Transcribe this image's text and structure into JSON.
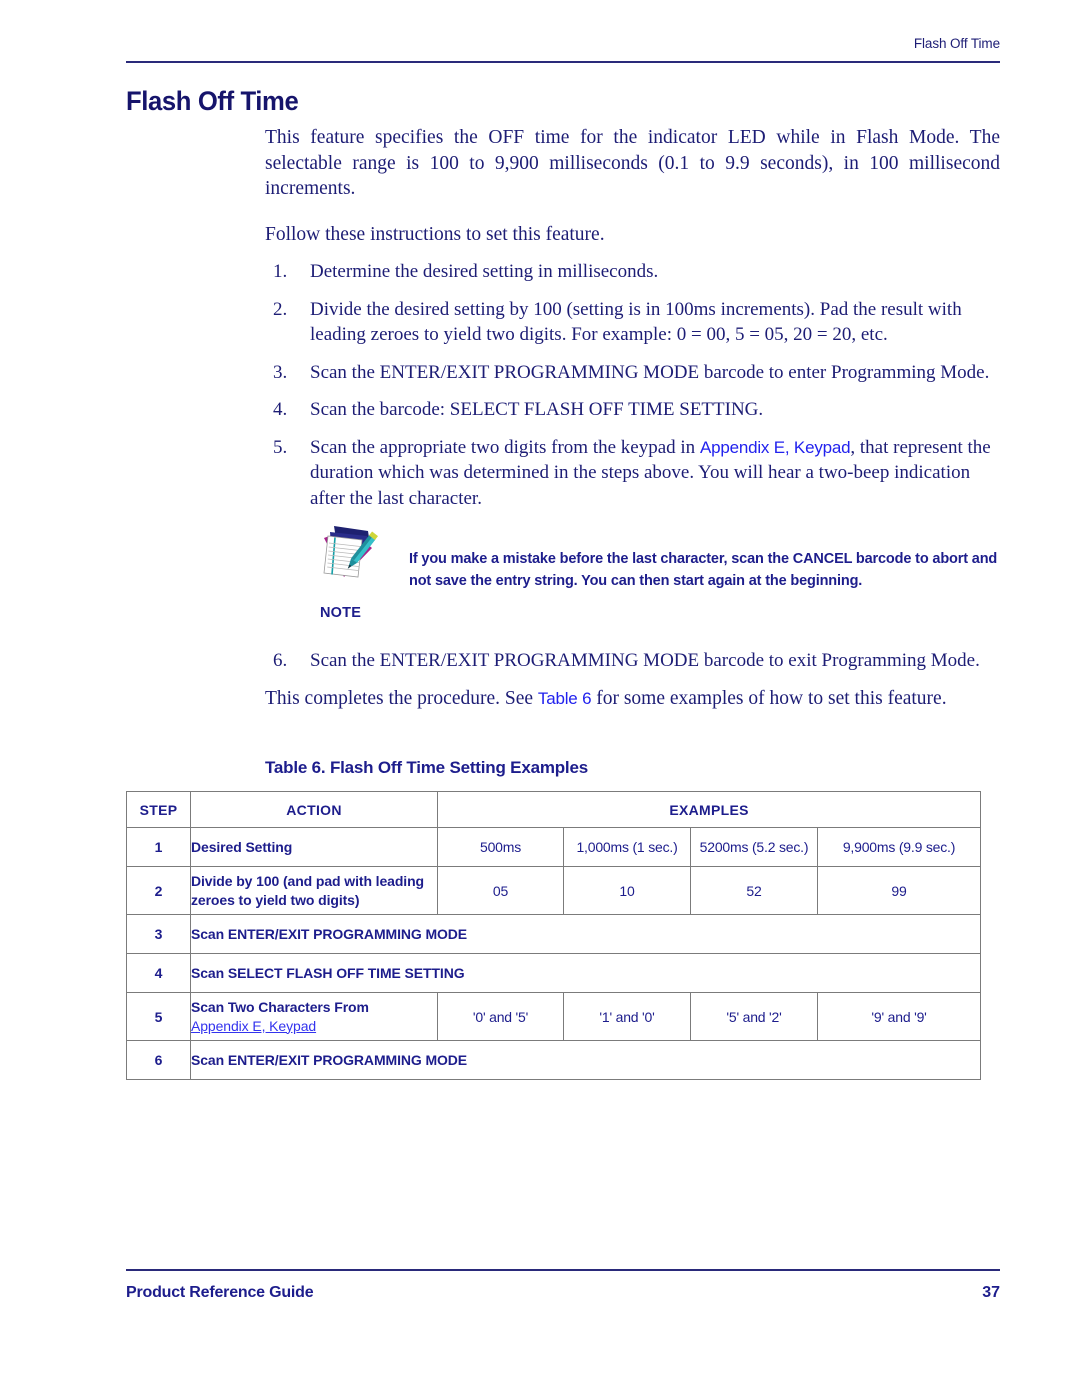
{
  "header": {
    "running_title": "Flash Off Time"
  },
  "title": "Flash Off Time",
  "intro": {
    "paragraph1": "This feature specifies the OFF time for the indicator LED while in Flash Mode. The selectable range is 100 to 9,900 milliseconds (0.1 to 9.9 seconds), in 100 millisecond increments.",
    "paragraph2": "Follow these instructions to set this feature."
  },
  "steps": [
    {
      "num": "1.",
      "text": "Determine the desired setting in milliseconds."
    },
    {
      "num": "2.",
      "text": "Divide the desired setting by 100 (setting is in 100ms increments). Pad the result with leading zeroes to yield two digits. For example: 0 = 00, 5 = 05, 20 = 20, etc."
    },
    {
      "num": "3.",
      "text": "Scan the ENTER/EXIT PROGRAMMING MODE barcode to enter Programming Mode."
    },
    {
      "num": "4.",
      "text": "Scan the barcode: SELECT FLASH OFF TIME SETTING."
    },
    {
      "num": "5.",
      "text_before": "Scan the appropriate two digits from the keypad in ",
      "link": "Appendix E, Keypad",
      "text_after": ", that represent the duration which was determined in the steps above. You will hear a two-beep indication after the last character."
    },
    {
      "num": "6.",
      "text": "Scan the ENTER/EXIT PROGRAMMING MODE barcode to exit Programming Mode."
    }
  ],
  "note": {
    "label": "NOTE",
    "text": "If you make a mistake before the last character, scan the CANCEL barcode to abort and not save the entry string. You can then start again at the beginning."
  },
  "closing": {
    "text_before": "This completes the procedure. See ",
    "link": "Table 6",
    "text_after": " for some examples of how to set this feature."
  },
  "table": {
    "caption": "Table 6. Flash Off Time Setting Examples",
    "headers": {
      "step": "STEP",
      "action": "ACTION",
      "examples": "EXAMPLES"
    },
    "rows": [
      {
        "step": "1",
        "action": "Desired Setting",
        "action_link": "",
        "spans_full": false,
        "examples": [
          "500ms",
          "1,000ms (1 sec.)",
          "5200ms (5.2 sec.)",
          "9,900ms (9.9 sec.)"
        ]
      },
      {
        "step": "2",
        "action": "Divide by 100 (and pad with leading zeroes to yield two digits)",
        "action_link": "",
        "spans_full": false,
        "examples": [
          "05",
          "10",
          "52",
          "99"
        ]
      },
      {
        "step": "3",
        "action": "Scan ENTER/EXIT PROGRAMMING MODE",
        "action_link": "",
        "spans_full": true,
        "examples": []
      },
      {
        "step": "4",
        "action": "Scan SELECT FLASH OFF TIME SETTING",
        "action_link": "",
        "spans_full": true,
        "examples": []
      },
      {
        "step": "5",
        "action": "Scan Two Characters From",
        "action_link": "Appendix E, Keypad",
        "spans_full": false,
        "examples": [
          "'0' and '5'",
          "'1' and '0'",
          "'5' and '2'",
          "'9' and '9'"
        ]
      },
      {
        "step": "6",
        "action": "Scan ENTER/EXIT PROGRAMMING MODE",
        "action_link": "",
        "spans_full": true,
        "examples": []
      }
    ]
  },
  "footer": {
    "guide": "Product Reference Guide",
    "page": "37"
  },
  "colors": {
    "body_navy": "#1d1d75",
    "heading_navy": "#16146b",
    "link_blue": "#2222ee",
    "rule": "#2a2a7a",
    "table_border": "#7b7b7b"
  }
}
